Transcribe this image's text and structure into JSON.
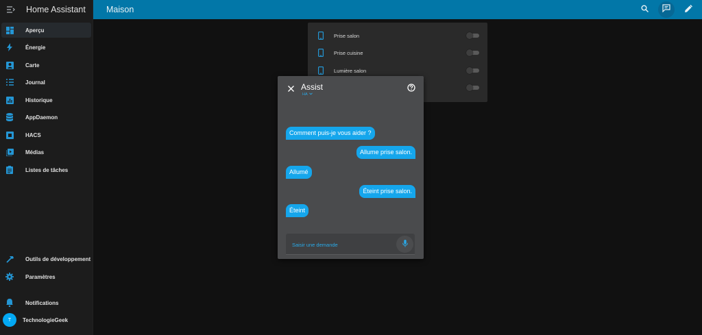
{
  "app": {
    "title": "Home Assistant"
  },
  "topbar": {
    "title": "Maison",
    "search_icon": "search-icon",
    "assist_icon": "assist-icon",
    "edit_icon": "pencil-icon"
  },
  "sidebar": {
    "items": [
      {
        "label": "Aperçu",
        "icon": "dashboard-icon",
        "active": true
      },
      {
        "label": "Énergie",
        "icon": "lightning-icon"
      },
      {
        "label": "Carte",
        "icon": "map-icon"
      },
      {
        "label": "Journal",
        "icon": "list-icon"
      },
      {
        "label": "Historique",
        "icon": "chart-icon"
      },
      {
        "label": "AppDaemon",
        "icon": "database-icon"
      },
      {
        "label": "HACS",
        "icon": "store-icon"
      },
      {
        "label": "Médias",
        "icon": "media-icon"
      },
      {
        "label": "Listes de tâches",
        "icon": "clipboard-icon"
      }
    ],
    "bottom": [
      {
        "label": "Outils de développement",
        "icon": "hammer-icon"
      },
      {
        "label": "Paramètres",
        "icon": "gear-icon"
      },
      {
        "label": "Notifications",
        "icon": "bell-icon"
      }
    ],
    "user": {
      "initial": "T",
      "name": "TechnologieGeek"
    }
  },
  "entities": [
    {
      "label": "Prise salon",
      "state": "off"
    },
    {
      "label": "Prise cuisine",
      "state": "off"
    },
    {
      "label": "Lumière salon",
      "state": "off"
    },
    {
      "label": "",
      "state": "off"
    }
  ],
  "assist": {
    "title": "Assist",
    "pipeline": "HA",
    "messages": [
      {
        "from": "hass",
        "text": "Comment puis-je vous aider ?"
      },
      {
        "from": "user",
        "text": "Allume prise salon."
      },
      {
        "from": "hass",
        "text": "Allumé"
      },
      {
        "from": "user",
        "text": "Éteint prise salon."
      },
      {
        "from": "hass",
        "text": "Éteint"
      }
    ],
    "input_placeholder": "Saisir une demande",
    "input_value": ""
  },
  "colors": {
    "accent": "#03a9f4",
    "topbar": "#0277a8",
    "bubble": "#15a6ec",
    "sidebar_icon": "#2496d4"
  }
}
